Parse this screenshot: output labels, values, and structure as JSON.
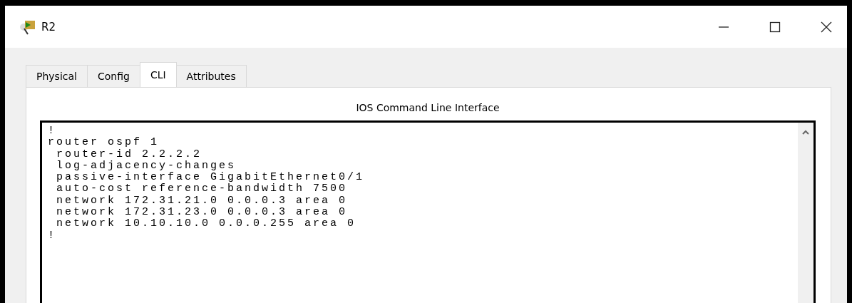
{
  "window": {
    "title": "R2"
  },
  "tabs": [
    {
      "label": "Physical",
      "selected": false
    },
    {
      "label": "Config",
      "selected": false
    },
    {
      "label": "CLI",
      "selected": true
    },
    {
      "label": "Attributes",
      "selected": false
    }
  ],
  "panel": {
    "heading": "IOS Command Line Interface"
  },
  "cli": {
    "lines": [
      "!",
      "router ospf 1",
      " router-id 2.2.2.2",
      " log-adjacency-changes",
      " passive-interface GigabitEthernet0/1",
      " auto-cost reference-bandwidth 7500",
      " network 172.31.21.0 0.0.0.3 area 0",
      " network 172.31.23.0 0.0.0.3 area 0",
      " network 10.10.10.0 0.0.0.255 area 0",
      "!"
    ]
  }
}
